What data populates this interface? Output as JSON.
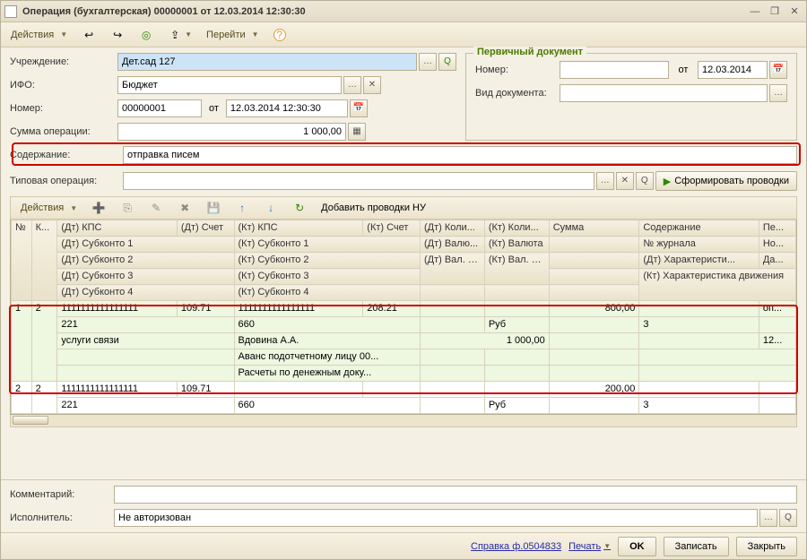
{
  "window": {
    "title": "Операция (бухгалтерская) 00000001 от 12.03.2014 12:30:30"
  },
  "toolbar": {
    "actions": "Действия",
    "goto": "Перейти"
  },
  "form": {
    "inst_label": "Учреждение:",
    "inst_value": "Дет.сад 127",
    "ifo_label": "ИФО:",
    "ifo_value": "Бюджет",
    "number_label": "Номер:",
    "number_value": "00000001",
    "ot": "от",
    "date_value": "12.03.2014 12:30:30",
    "sum_label": "Сумма операции:",
    "sum_value": "1 000,00",
    "content_label": "Содержание:",
    "content_value": "отправка писем",
    "type_label": "Типовая операция:",
    "type_value": "",
    "form_btn": "Сформировать проводки"
  },
  "primary": {
    "legend": "Первичный документ",
    "number_label": "Номер:",
    "number_value": "",
    "ot": "от",
    "date_value": "12.03.2014",
    "doctype_label": "Вид документа:",
    "doctype_value": ""
  },
  "subtoolbar": {
    "actions": "Действия",
    "add_nu": "Добавить проводки НУ"
  },
  "grid": {
    "headers": {
      "n": "№",
      "k": "К...",
      "dt_kps": "(Дт) КПС",
      "dt_acct": "(Дт) Счет",
      "kt_kps": "(Кт) КПС",
      "kt_acct": "(Кт) Счет",
      "dt_qty": "(Дт) Коли...",
      "kt_qty": "(Кт) Коли...",
      "sum": "Сумма",
      "content": "Содержание",
      "per": "Пе...",
      "dt_sub1": "(Дт) Субконто 1",
      "kt_sub1": "(Кт) Субконто 1",
      "dt_cur": "(Дт) Валю...",
      "kt_cur": "(Кт) Валюта",
      "journal": "№ журнала",
      "no": "Но...",
      "dt_sub2": "(Дт) Субконто 2",
      "kt_sub2": "(Кт) Субконто 2",
      "dt_vsum": "(Дт) Вал. сумма",
      "kt_vsum": "(Кт) Вал. сумма",
      "dt_char": "(Дт) Характеристи...",
      "da": "Да...",
      "dt_sub3": "(Дт) Субконто 3",
      "kt_sub3": "(Кт) Субконто 3",
      "kt_char": "(Кт) Характеристика движения",
      "dt_sub4": "(Дт) Субконто 4",
      "kt_sub4": "(Кт) Субконто 4"
    },
    "rows": [
      {
        "n": "1",
        "k": "2",
        "dt_kps": "1111111111111111",
        "dt_acct": "109.71",
        "kt_kps": "1111111111111111",
        "kt_acct": "208.21",
        "sum": "800,00",
        "content": "оп...",
        "dt_sub1": "221",
        "kt_sub1": "660",
        "kt_cur": "Руб",
        "journal": "3",
        "dt_sub2": "услуги связи",
        "kt_sub2": "Вдовина А.А.",
        "dt_vsum": "1 000,00",
        "da": "12...",
        "kt_sub3": "Аванс подотчетному лицу 00...",
        "kt_sub4": "Расчеты по денежным доку..."
      },
      {
        "n": "2",
        "k": "2",
        "dt_kps": "1111111111111111",
        "dt_acct": "109.71",
        "kt_kps": "",
        "kt_acct": "",
        "sum": "200,00",
        "dt_sub1": "221",
        "kt_sub1": "660",
        "kt_cur": "Руб",
        "journal": "3"
      }
    ]
  },
  "bottom": {
    "comment_label": "Комментарий:",
    "comment_value": "",
    "exec_label": "Исполнитель:",
    "exec_value": "Не авторизован"
  },
  "footer": {
    "ref": "Справка ф.0504833",
    "print": "Печать",
    "ok": "OK",
    "save": "Записать",
    "close": "Закрыть"
  }
}
